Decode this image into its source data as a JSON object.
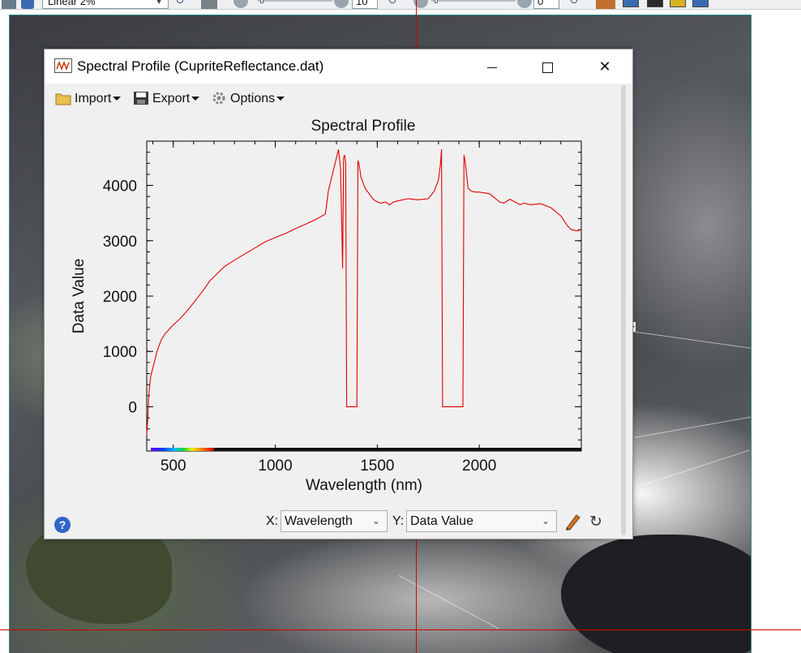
{
  "toolbar": {
    "stretch_value": "Linear 2%",
    "brightness_value": "10",
    "contrast_value": "0"
  },
  "dialog": {
    "title": "Spectral Profile (CupriteReflectance.dat)",
    "menu": {
      "import_label": "Import",
      "export_label": "Export",
      "options_label": "Options"
    }
  },
  "plot": {
    "title": "Spectral Profile"
  },
  "footer": {
    "x_label": "X:",
    "x_value": "Wavelength",
    "y_label": "Y:",
    "y_value": "Data Value",
    "help_glyph": "?"
  },
  "colors": {
    "spectrum_line": "#e00000",
    "crosshair": "#d40000",
    "help_icon": "#2f67c9"
  },
  "icons": [
    "import-folder-icon",
    "export-disk-icon",
    "options-gear-icon",
    "help-icon",
    "pen-icon",
    "refresh-icon"
  ],
  "chart_data": {
    "type": "line",
    "title": "Spectral Profile",
    "xlabel": "Wavelength (nm)",
    "ylabel": "Data Value",
    "xlim": [
      370,
      2500
    ],
    "ylim": [
      -800,
      4800
    ],
    "x_ticks": [
      500,
      1000,
      1500,
      2000
    ],
    "y_ticks": [
      0,
      1000,
      2000,
      3000,
      4000
    ],
    "grid": false,
    "series": [
      {
        "x": [
          370,
          375,
          380,
          385,
          390,
          400,
          410,
          420,
          440,
          460,
          480,
          500,
          530,
          560,
          600,
          650,
          680,
          700,
          750,
          800,
          850,
          900,
          950,
          1000,
          1050,
          1100,
          1150,
          1200,
          1230,
          1245,
          1250,
          1260,
          1280,
          1300,
          1310,
          1320,
          1330,
          1335,
          1340,
          1345,
          1350,
          1355,
          1360,
          1370,
          1380,
          1390,
          1400,
          1405,
          1410,
          1420,
          1440,
          1460,
          1480,
          1500,
          1520,
          1540,
          1560,
          1580,
          1600,
          1650,
          1700,
          1750,
          1780,
          1800,
          1810,
          1815,
          1820,
          1825,
          1830,
          1850,
          1880,
          1900,
          1910,
          1920,
          1925,
          1930,
          1935,
          1945,
          1960,
          1980,
          2000,
          2050,
          2100,
          2120,
          2150,
          2200,
          2220,
          2250,
          2300,
          2350,
          2400,
          2430,
          2450,
          2480,
          2500
        ],
        "y": [
          -500,
          -200,
          200,
          400,
          560,
          700,
          850,
          1000,
          1200,
          1320,
          1400,
          1480,
          1580,
          1700,
          1880,
          2120,
          2280,
          2350,
          2530,
          2650,
          2760,
          2870,
          2980,
          3060,
          3130,
          3220,
          3300,
          3390,
          3450,
          3480,
          3600,
          3900,
          4200,
          4500,
          4650,
          4300,
          2500,
          4500,
          4550,
          4400,
          0,
          0,
          0,
          0,
          0,
          0,
          0,
          4450,
          4400,
          4150,
          3950,
          3850,
          3750,
          3700,
          3680,
          3700,
          3650,
          3700,
          3720,
          3760,
          3740,
          3760,
          3900,
          4100,
          4400,
          4650,
          0,
          0,
          0,
          0,
          0,
          0,
          0,
          0,
          4550,
          4450,
          4300,
          3950,
          3900,
          3880,
          3880,
          3850,
          3700,
          3680,
          3750,
          3650,
          3680,
          3650,
          3670,
          3600,
          3450,
          3280,
          3200,
          3180,
          3200
        ]
      }
    ]
  }
}
